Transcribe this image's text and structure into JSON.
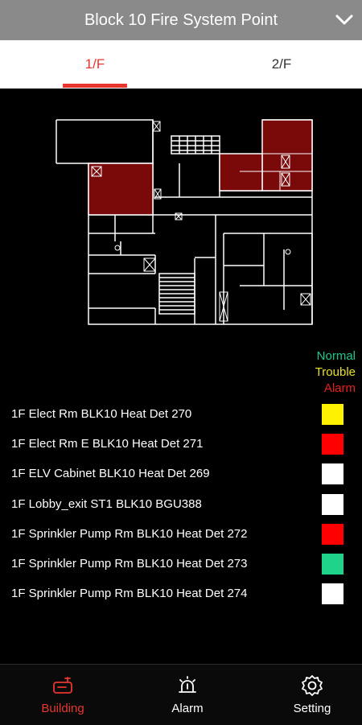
{
  "header": {
    "title": "Block 10 Fire System Point"
  },
  "tabs": [
    "1/F",
    "2/F"
  ],
  "legend": {
    "normal": "Normal",
    "trouble": "Trouble",
    "alarm": "Alarm"
  },
  "colors": {
    "accent": "#e8362e",
    "normal": "#1fc88a",
    "trouble": "#e8e027",
    "alarm": "#e8201e",
    "idle": "#ffffff",
    "alarm_zone": "#7a0a0a"
  },
  "points": [
    {
      "label": "1F Elect Rm BLK10 Heat Det 270",
      "status": "trouble",
      "color": "#fff200"
    },
    {
      "label": "1F Elect Rm E BLK10 Heat Det 271",
      "status": "alarm",
      "color": "#ff0000"
    },
    {
      "label": "1F ELV Cabinet  BLK10 Heat Det 269",
      "status": "idle",
      "color": "#ffffff"
    },
    {
      "label": "1F Lobby_exit ST1 BLK10 BGU388",
      "status": "idle",
      "color": "#ffffff"
    },
    {
      "label": "1F Sprinkler Pump Rm BLK10 Heat Det 272",
      "status": "alarm",
      "color": "#ff0000"
    },
    {
      "label": "1F Sprinkler Pump Rm BLK10 Heat Det 273",
      "status": "normal",
      "color": "#1fd48a"
    },
    {
      "label": "1F Sprinkler Pump Rm BLK10 Heat Det 274",
      "status": "idle",
      "color": "#ffffff"
    }
  ],
  "nav": [
    {
      "label": "Building",
      "icon": "building-icon"
    },
    {
      "label": "Alarm",
      "icon": "alarm-icon"
    },
    {
      "label": "Setting",
      "icon": "gear-icon"
    }
  ]
}
